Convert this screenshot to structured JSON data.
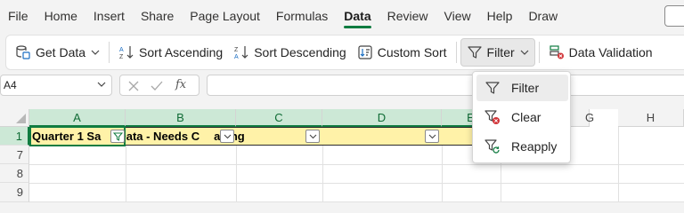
{
  "menu": {
    "items": [
      "File",
      "Home",
      "Insert",
      "Share",
      "Page Layout",
      "Formulas",
      "Data",
      "Review",
      "View",
      "Help",
      "Draw"
    ],
    "active": "Data"
  },
  "ribbon": {
    "get_data": "Get Data",
    "sort_asc": "Sort Ascending",
    "sort_desc": "Sort Descending",
    "custom_sort": "Custom Sort",
    "filter": "Filter",
    "data_validation": "Data Validation"
  },
  "formula_bar": {
    "name_box": "A4",
    "fx": "fx",
    "value": ""
  },
  "grid": {
    "columns": [
      "A",
      "B",
      "C",
      "D",
      "E",
      "G",
      "H"
    ],
    "rows": [
      "1",
      "7",
      "8",
      "9"
    ],
    "cell_a1": "Quarter 1 Sa",
    "cell_b1": "Data - Needs C",
    "cell_c1": "aning"
  },
  "filter_menu": {
    "items": [
      "Filter",
      "Clear",
      "Reapply"
    ],
    "highlighted": "Filter"
  },
  "colors": {
    "accent": "#107c41",
    "header_fill": "#fff2a8",
    "selected_header": "#cce8d6"
  }
}
